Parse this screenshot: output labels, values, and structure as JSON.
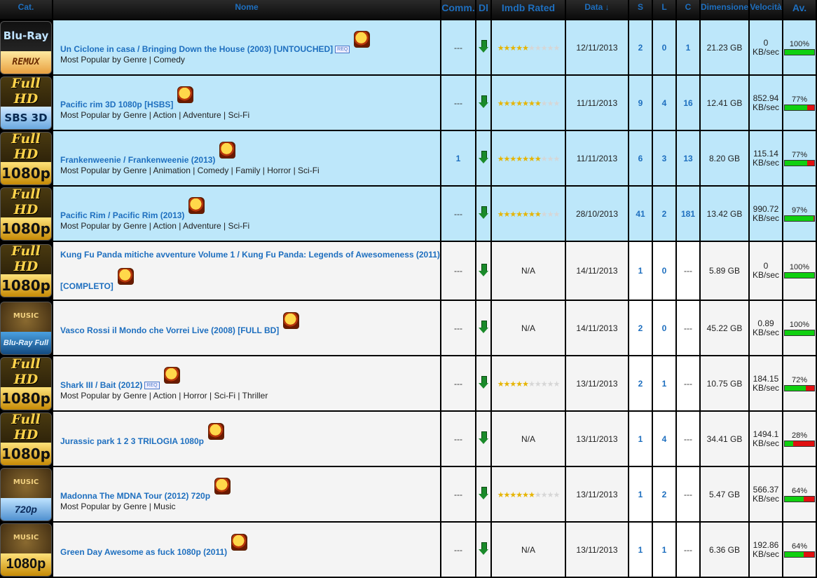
{
  "headers": {
    "cat": "Cat.",
    "name": "Nome",
    "comm": "Comm.",
    "dl": "Dl",
    "imdb": "Imdb Rated",
    "date": "Data ↓",
    "s": "S",
    "l": "L",
    "c": "C",
    "size": "Dimensione",
    "speed": "Velocità",
    "av": "Av."
  },
  "colors": {
    "link_blue": "#1e6fbf",
    "highlight_row": "#bde7fa",
    "normal_row": "#f4f4f4",
    "bar_green": "#10d010",
    "bar_red": "#e01010"
  },
  "rows": [
    {
      "badge_top": "Blu-Ray",
      "badge_bottom": "REMUX",
      "badge_style": "blu",
      "title": "Un Ciclone in casa / Bringing Down the House (2003) [UNTOUCHED]",
      "req": "REQ",
      "genre": "Most Popular by Genre | Comedy",
      "comm": "---",
      "rating": 5,
      "rating_text": "",
      "date": "12/11/2013",
      "s": "2",
      "l": "0",
      "c": "1",
      "size": "21.23 GB",
      "speed_val": "0",
      "speed_unit": "KB/sec",
      "av": "100%",
      "av_fraction": 1.0,
      "highlight": true
    },
    {
      "badge_top": "Full HD",
      "badge_bottom": "SBS 3D",
      "badge_style": "sbs",
      "title": "Pacific rim 3D 1080p [HSBS]",
      "req": "",
      "genre": "Most Popular by Genre | Action | Adventure | Sci-Fi",
      "comm": "---",
      "rating": 7,
      "rating_text": "",
      "date": "11/11/2013",
      "s": "9",
      "l": "4",
      "c": "16",
      "size": "12.41 GB",
      "speed_val": "852.94",
      "speed_unit": "KB/sec",
      "av": "77%",
      "av_fraction": 0.77,
      "highlight": true
    },
    {
      "badge_top": "Full HD",
      "badge_bottom": "1080p",
      "badge_style": "fhd",
      "title": "Frankenweenie / Frankenweenie (2013)",
      "req": "",
      "genre": "Most Popular by Genre | Animation | Comedy | Family | Horror | Sci-Fi",
      "comm": "1",
      "rating": 7,
      "rating_text": "",
      "date": "11/11/2013",
      "s": "6",
      "l": "3",
      "c": "13",
      "size": "8.20 GB",
      "speed_val": "115.14",
      "speed_unit": "KB/sec",
      "av": "77%",
      "av_fraction": 0.77,
      "highlight": true
    },
    {
      "badge_top": "Full HD",
      "badge_bottom": "1080p",
      "badge_style": "fhd",
      "title": "Pacific Rim / Pacific Rim (2013)",
      "req": "",
      "genre": "Most Popular by Genre | Action | Adventure | Sci-Fi",
      "comm": "---",
      "rating": 7,
      "rating_text": "",
      "date": "28/10/2013",
      "s": "41",
      "l": "2",
      "c": "181",
      "size": "13.42 GB",
      "speed_val": "990.72",
      "speed_unit": "KB/sec",
      "av": "97%",
      "av_fraction": 0.97,
      "highlight": true
    },
    {
      "badge_top": "Full HD",
      "badge_bottom": "1080p",
      "badge_style": "fhd",
      "title": "Kung Fu Panda mitiche avventure Volume 1 / Kung Fu Panda: Legends of Awesomeness (2011) [COMPLETO]",
      "req": "",
      "genre": "",
      "comm": "---",
      "rating": 0,
      "rating_text": "N/A",
      "date": "14/11/2013",
      "s": "1",
      "l": "0",
      "c": "---",
      "size": "5.89 GB",
      "speed_val": "0",
      "speed_unit": "KB/sec",
      "av": "100%",
      "av_fraction": 1.0,
      "highlight": false
    },
    {
      "badge_top": "MUSIC",
      "badge_bottom": "Blu-Ray Full",
      "badge_style": "music-bl",
      "title": "Vasco Rossi il Mondo che Vorrei Live (2008) [FULL BD]",
      "req": "",
      "genre": "",
      "comm": "---",
      "rating": 0,
      "rating_text": "N/A",
      "date": "14/11/2013",
      "s": "2",
      "l": "0",
      "c": "---",
      "size": "45.22 GB",
      "speed_val": "0.89",
      "speed_unit": "KB/sec",
      "av": "100%",
      "av_fraction": 1.0,
      "highlight": false
    },
    {
      "badge_top": "Full HD",
      "badge_bottom": "1080p",
      "badge_style": "fhd",
      "title": "Shark III / Bait (2012)",
      "req": "REQ",
      "genre": "Most Popular by Genre | Action | Horror | Sci-Fi | Thriller",
      "comm": "---",
      "rating": 5,
      "rating_text": "",
      "date": "13/11/2013",
      "s": "2",
      "l": "1",
      "c": "---",
      "size": "10.75 GB",
      "speed_val": "184.15",
      "speed_unit": "KB/sec",
      "av": "72%",
      "av_fraction": 0.72,
      "highlight": false
    },
    {
      "badge_top": "Full HD",
      "badge_bottom": "1080p",
      "badge_style": "fhd",
      "title": "Jurassic park 1 2 3 TRILOGIA 1080p",
      "req": "",
      "genre": "",
      "comm": "---",
      "rating": 0,
      "rating_text": "N/A",
      "date": "13/11/2013",
      "s": "1",
      "l": "4",
      "c": "---",
      "size": "34.41 GB",
      "speed_val": "1494.1",
      "speed_unit": "KB/sec",
      "av": "28%",
      "av_fraction": 0.28,
      "highlight": false
    },
    {
      "badge_top": "MUSIC",
      "badge_bottom": "720p",
      "badge_style": "music-720",
      "title": "Madonna The MDNA Tour (2012) 720p",
      "req": "",
      "genre": "Most Popular by Genre | Music",
      "comm": "---",
      "rating": 6,
      "rating_text": "",
      "date": "13/11/2013",
      "s": "1",
      "l": "2",
      "c": "---",
      "size": "5.47 GB",
      "speed_val": "566.37",
      "speed_unit": "KB/sec",
      "av": "64%",
      "av_fraction": 0.64,
      "highlight": false
    },
    {
      "badge_top": "MUSIC",
      "badge_bottom": "1080p",
      "badge_style": "music-mp",
      "title": "Green Day Awesome as fuck 1080p (2011)",
      "req": "",
      "genre": "",
      "comm": "---",
      "rating": 0,
      "rating_text": "N/A",
      "date": "13/11/2013",
      "s": "1",
      "l": "1",
      "c": "---",
      "size": "6.36 GB",
      "speed_val": "192.86",
      "speed_unit": "KB/sec",
      "av": "64%",
      "av_fraction": 0.64,
      "highlight": false
    }
  ]
}
